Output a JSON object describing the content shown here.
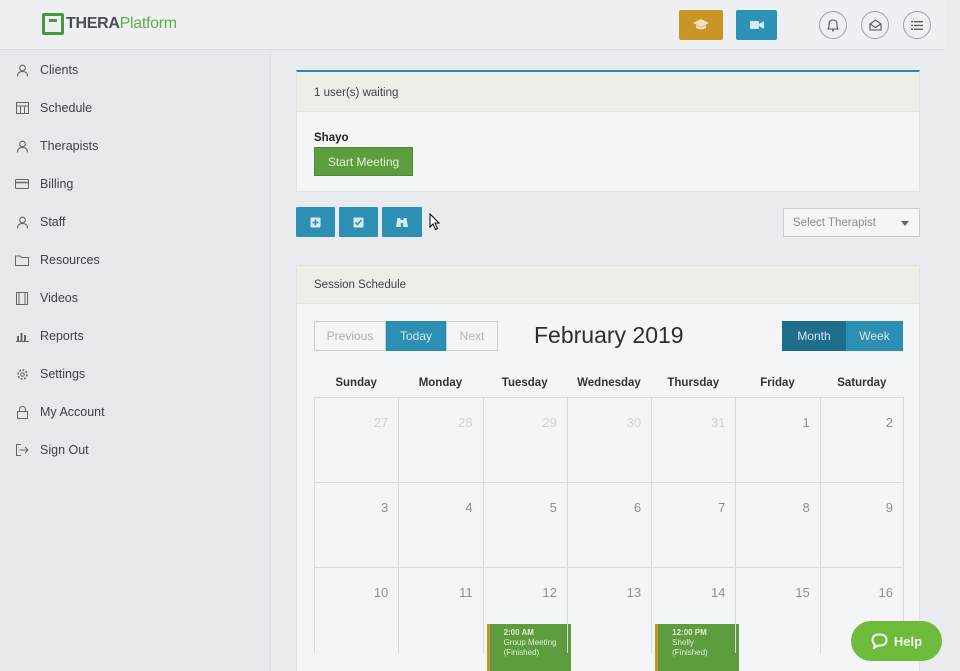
{
  "header": {
    "logo_thera": "THERA",
    "logo_platform": "Platform",
    "icons": [
      "graduation-cap-icon",
      "video-camera-icon",
      "bell-icon",
      "mail-icon",
      "menu-list-icon"
    ],
    "colors": {
      "orange": "#c99526",
      "blue": "#2c93b5"
    }
  },
  "sidebar": {
    "items": [
      {
        "label": "Clients",
        "icon": "clients-icon"
      },
      {
        "label": "Schedule",
        "icon": "schedule-icon"
      },
      {
        "label": "Therapists",
        "icon": "therapists-icon"
      },
      {
        "label": "Billing",
        "icon": "billing-icon"
      },
      {
        "label": "Staff",
        "icon": "staff-icon"
      },
      {
        "label": "Resources",
        "icon": "folder-icon"
      },
      {
        "label": "Videos",
        "icon": "video-icon"
      },
      {
        "label": "Reports",
        "icon": "chart-icon"
      },
      {
        "label": "Settings",
        "icon": "gear-icon"
      },
      {
        "label": "My Account",
        "icon": "lock-icon"
      },
      {
        "label": "Sign Out",
        "icon": "sign-out-icon"
      }
    ]
  },
  "waiting": {
    "heading": "1 user(s) waiting",
    "user_name": "Shayo",
    "start_label": "Start Meeting"
  },
  "toolbar": {
    "buttons": [
      "add-icon",
      "checkbox-icon",
      "binoculars-icon"
    ],
    "therapist_select": "Select Therapist"
  },
  "schedule": {
    "heading": "Session Schedule",
    "prev_label": "Previous",
    "today_label": "Today",
    "next_label": "Next",
    "month_title": "February 2019",
    "month_label": "Month",
    "week_label": "Week",
    "days_of_week": [
      "Sunday",
      "Monday",
      "Tuesday",
      "Wednesday",
      "Thursday",
      "Friday",
      "Saturday"
    ],
    "weeks": [
      [
        {
          "n": "27",
          "other": true
        },
        {
          "n": "28",
          "other": true
        },
        {
          "n": "29",
          "other": true
        },
        {
          "n": "30",
          "other": true
        },
        {
          "n": "31",
          "other": true
        },
        {
          "n": "1"
        },
        {
          "n": "2"
        }
      ],
      [
        {
          "n": "3"
        },
        {
          "n": "4"
        },
        {
          "n": "5"
        },
        {
          "n": "6"
        },
        {
          "n": "7"
        },
        {
          "n": "8"
        },
        {
          "n": "9"
        }
      ],
      [
        {
          "n": "10"
        },
        {
          "n": "11"
        },
        {
          "n": "12",
          "event": {
            "time": "2:00 AM",
            "title": "Group Meeting",
            "status": "(Finished)"
          }
        },
        {
          "n": "13"
        },
        {
          "n": "14",
          "event": {
            "time": "12:00 PM",
            "title": "Shelly",
            "status": "(Finished)"
          }
        },
        {
          "n": "15"
        },
        {
          "n": "16"
        }
      ]
    ]
  },
  "help": {
    "label": "Help"
  }
}
